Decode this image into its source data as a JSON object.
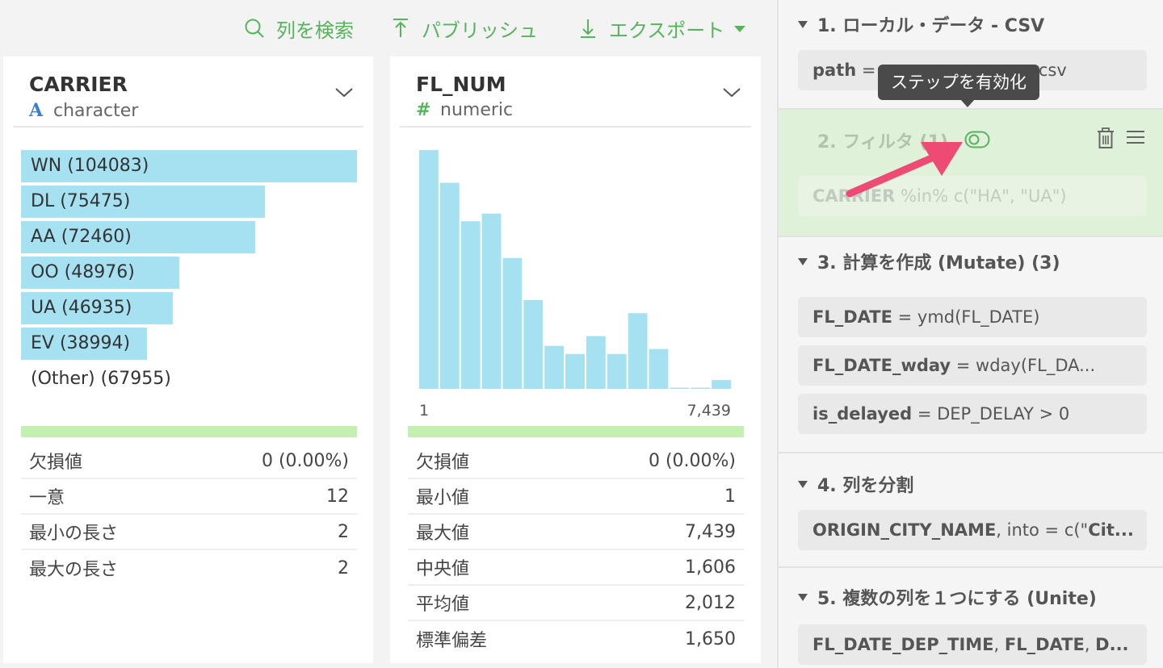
{
  "toolbar": {
    "search_label": "列を検索",
    "publish_label": "パブリッシュ",
    "export_label": "エクスポート",
    "accent_color": "#56b45c"
  },
  "columns": {
    "carrier": {
      "name": "CARRIER",
      "type_icon": "A",
      "type": "character",
      "bars": [
        {
          "label": "WN (104083)",
          "value": 104083
        },
        {
          "label": "DL (75475)",
          "value": 75475
        },
        {
          "label": "AA (72460)",
          "value": 72460
        },
        {
          "label": "OO (48976)",
          "value": 48976
        },
        {
          "label": "UA (46935)",
          "value": 46935
        },
        {
          "label": "EV (38994)",
          "value": 38994
        },
        {
          "label": "(Other) (67955)",
          "value": 67955
        }
      ],
      "stats": [
        {
          "label": "欠損値",
          "value": "0 (0.00%)"
        },
        {
          "label": "一意",
          "value": "12"
        },
        {
          "label": "最小の長さ",
          "value": "2"
        },
        {
          "label": "最大の長さ",
          "value": "2"
        }
      ]
    },
    "flnum": {
      "name": "FL_NUM",
      "type_icon": "#",
      "type": "numeric",
      "hist_min": "1",
      "hist_max": "7,439",
      "stats": [
        {
          "label": "欠損値",
          "value": "0 (0.00%)"
        },
        {
          "label": "最小値",
          "value": "1"
        },
        {
          "label": "最大値",
          "value": "7,439"
        },
        {
          "label": "中央値",
          "value": "1,606"
        },
        {
          "label": "平均値",
          "value": "2,012"
        },
        {
          "label": "標準偏差",
          "value": "1,650"
        }
      ]
    }
  },
  "chart_data": {
    "type": "bar",
    "xlim": [
      1,
      7439
    ],
    "values": [
      100,
      86.3,
      70.2,
      73.4,
      54.8,
      37.2,
      18.0,
      14.6,
      22.1,
      14.6,
      31.7,
      16.7,
      0.5,
      0.5,
      3.7
    ],
    "color": "#a6e1f1"
  },
  "steps": [
    {
      "title": "1. ローカル・データ - CSV",
      "cmd_key": "path",
      "cmd_rest": " = ",
      "cmd_tail": ".csv"
    },
    {
      "title": "2. フィルタ (1)",
      "cmd_key": "CARRIER",
      "cmd_rest": " %in% c(\"HA\", \"UA\")",
      "disabled": true
    },
    {
      "title": "3. 計算を作成 (Mutate) (3)",
      "cmds": [
        {
          "key": "FL_DATE",
          "rest": " = ymd(FL_DATE)"
        },
        {
          "key": "FL_DATE_wday",
          "rest": " = wday(FL_DA..."
        },
        {
          "key": "is_delayed",
          "rest": " = DEP_DELAY > 0"
        }
      ]
    },
    {
      "title": "4. 列を分割",
      "cmd_key": "ORIGIN_CITY_NAME",
      "cmd_rest": ", into = c(\"",
      "cmd_bold2": "Cit..."
    },
    {
      "title": "5. 複数の列を１つにする (Unite)",
      "cmd_key": "FL_DATE_DEP_TIME",
      "cmd_rest": ", ",
      "cmd_bold2": "FL_DATE",
      "cmd_rest2": ", ",
      "cmd_bold3": "D..."
    }
  ],
  "tooltip": "ステップを有効化",
  "colors": {
    "bar_fill": "#a6e1f1",
    "green_line": "#c3efb0",
    "disabled_step_bg": "#dff1d9",
    "tooltip_bg": "#4a4a4a",
    "pointer_arrow": "#ee4a73"
  }
}
